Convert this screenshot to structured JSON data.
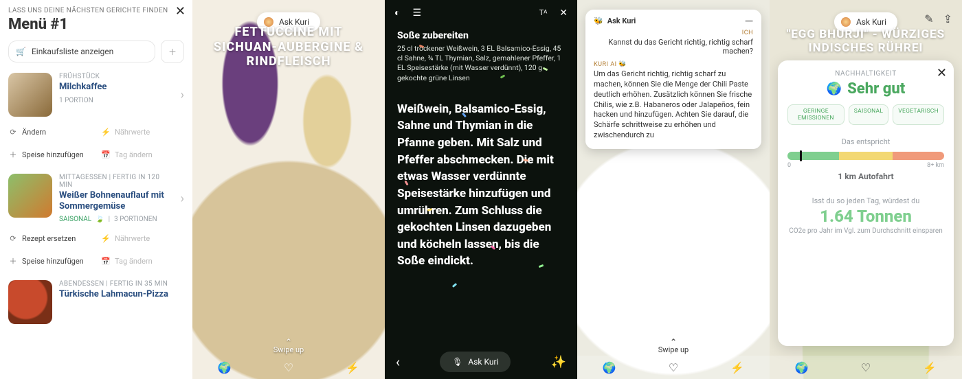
{
  "panel1": {
    "tagline": "LASS UNS DEINE NÄCHSTEN GERICHTE FINDEN",
    "title": "Menü #1",
    "shopping_list": "Einkaufsliste anzeigen",
    "actions": {
      "change": "Ändern",
      "nutrition": "Nährwerte",
      "add_dish": "Speise hinzufügen",
      "change_day": "Tag ändern",
      "replace_recipe": "Rezept ersetzen"
    },
    "items": [
      {
        "meal": "FRÜHSTÜCK",
        "title": "Milchkaffee",
        "portions": "1 PORTION"
      },
      {
        "meal": "MITTAGESSEN | FERTIG IN 120 MIN",
        "title": "Weißer Bohnenauflauf mit Sommergemüse",
        "saison": "SAISONAL",
        "portions": "3 PORTIONEN"
      },
      {
        "meal": "ABENDESSEN | FERTIG IN 35 MIN",
        "title": "Türkische Lahmacun-Pizza"
      }
    ]
  },
  "panel2": {
    "ask": "Ask Kuri",
    "title": "FETTUCCINE MIT SICHUAN-AUBERGINE & RINDFLEISCH",
    "swipe": "Swipe up"
  },
  "panel3": {
    "heading": "Soße zubereiten",
    "ingredients": "25 cl trockener Weißwein, 3 EL Balsamico-Essig, 45 cl Sahne, ¾ TL Thymian, Salz, gemahlener Pfeffer, 1 EL Speisestärke (mit Wasser verdünnt), 120 g gekochte grüne Linsen",
    "step": "Weißwein, Balsamico-Essig, Sahne und Thymian in die Pfanne geben. Mit Salz und Pfeffer abschmecken. Die mit etwas Wasser verdünnte Speisestärke hinzufügen und umrühren. Zum Schluss die gekochten Linsen dazugeben und köcheln lassen, bis die Soße eindickt.",
    "ask": "Ask Kuri"
  },
  "panel4": {
    "chat": {
      "title": "Ask Kuri",
      "user_label": "ICH",
      "user_msg": "Kannst du das Gericht richtig, richtig scharf machen?",
      "ai_label": "KURI AI 🐝",
      "ai_msg": "Um das Gericht richtig, richtig scharf zu machen, können Sie die Menge der Chili Paste deutlich erhöhen. Zusätzlich können Sie frische Chilis, wie z.B. Habaneros oder Jalapeños, fein hacken und hinzufügen. Achten Sie darauf, die Schärfe schrittweise zu erhöhen und zwischendurch zu"
    },
    "swipe": "Swipe up"
  },
  "panel5": {
    "ask": "Ask Kuri",
    "recipe_title": "\"EGG BHURJI\" - WÜRZIGES INDISCHES RÜHREI",
    "sheet": {
      "label": "NACHHALTIGKEIT",
      "rating": "Sehr gut",
      "chips": [
        "GERINGE EMISSIONEN",
        "SAISONAL",
        "VEGETARISCH"
      ],
      "equiv_label": "Das entspricht",
      "scale_min": "0",
      "scale_max": "8+ km",
      "km_line": "1 km Autofahrt",
      "yearly_lead": "Isst du so jeden Tag, würdest du",
      "yearly_value": "1.64 Tonnen",
      "yearly_tail": "CO2e pro Jahr im Vgl. zum Durchschnitt einsparen"
    }
  }
}
